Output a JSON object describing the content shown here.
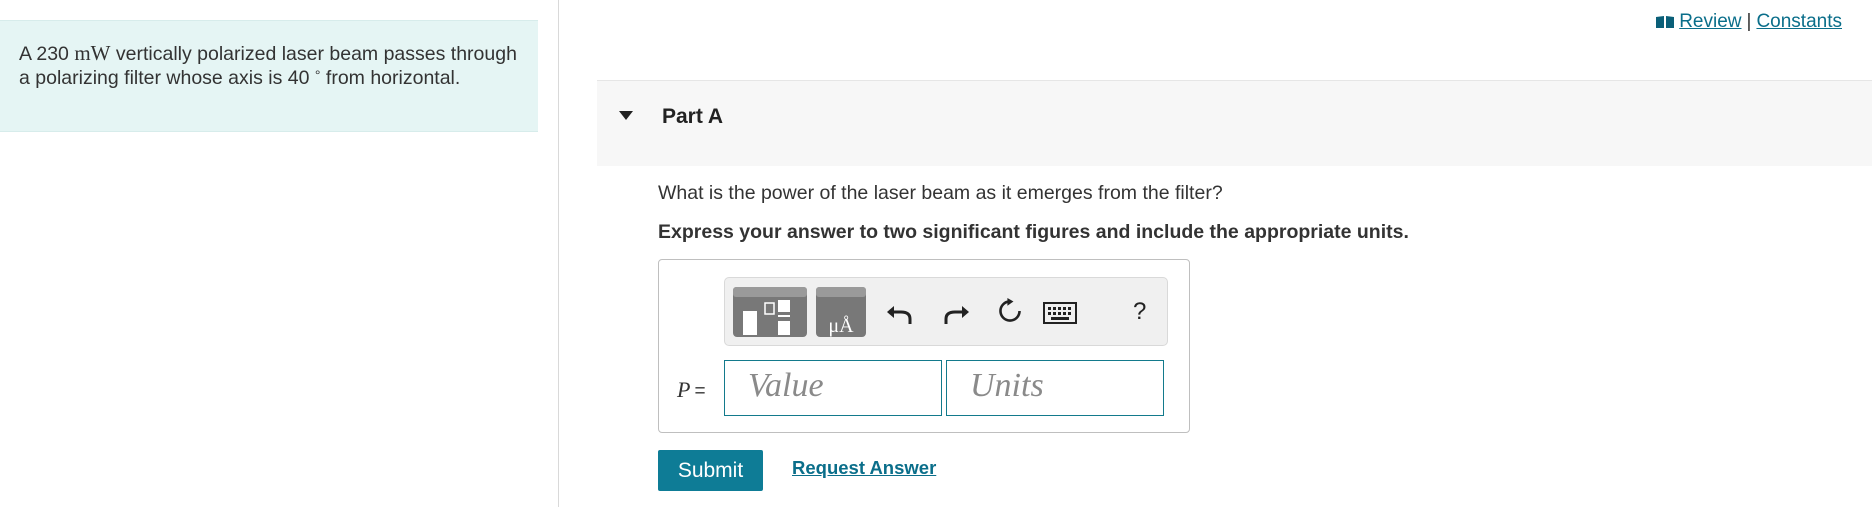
{
  "header": {
    "review_label": "Review",
    "separator": "|",
    "constants_label": "Constants"
  },
  "problem": {
    "text_1": "A 230 ",
    "unit": "mW",
    "text_2": " vertically polarized laser beam passes through a polarizing filter whose axis is 40 ",
    "degree": "°",
    "text_3": " from horizontal."
  },
  "part": {
    "title": "Part A",
    "question": "What is the power of the laser beam as it emerges from the filter?",
    "instruction": "Express your answer to two significant figures and include the appropriate units."
  },
  "answer": {
    "variable": "P",
    "equals": "=",
    "value_placeholder": "Value",
    "units_placeholder": "Units"
  },
  "toolbar": {
    "units_glyph": "μÅ",
    "help_glyph": "?",
    "icons": [
      "templates-icon",
      "units-icon",
      "undo-icon",
      "redo-icon",
      "reset-icon",
      "keyboard-icon",
      "help-icon"
    ]
  },
  "actions": {
    "submit_label": "Submit",
    "request_answer_label": "Request Answer"
  },
  "colors": {
    "accent": "#0e7c96",
    "link": "#0a6e8a",
    "problem_bg": "#e5f5f4",
    "toolbar_button": "#787878"
  }
}
